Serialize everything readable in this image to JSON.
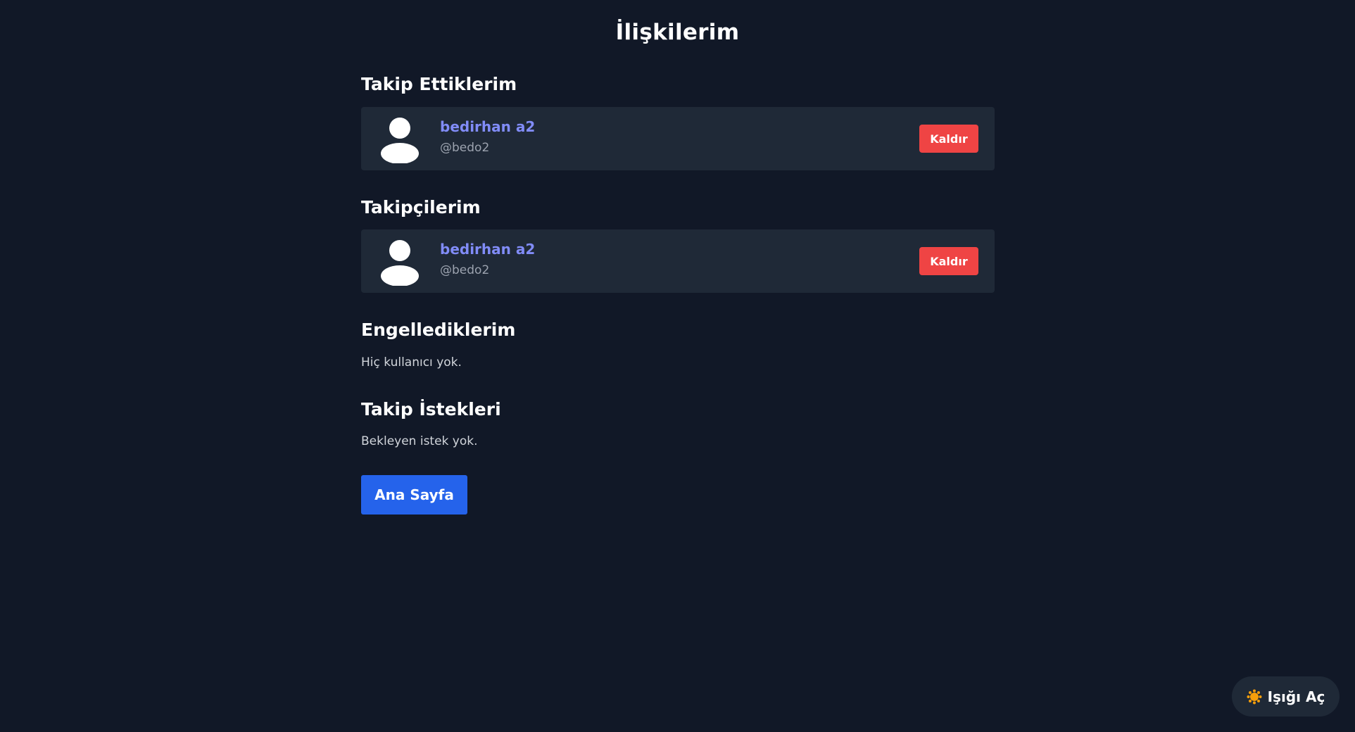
{
  "page": {
    "title": "İlişkilerim"
  },
  "following": {
    "heading": "Takip Ettiklerim",
    "users": [
      {
        "name": "bedirhan a2",
        "handle": "@bedo2",
        "action_label": "Kaldır"
      }
    ]
  },
  "followers": {
    "heading": "Takipçilerim",
    "users": [
      {
        "name": "bedirhan a2",
        "handle": "@bedo2",
        "action_label": "Kaldır"
      }
    ]
  },
  "blocked": {
    "heading": "Engellediklerim",
    "empty_text": "Hiç kullanıcı yok."
  },
  "requests": {
    "heading": "Takip İstekleri",
    "empty_text": "Bekleyen istek yok."
  },
  "nav": {
    "home_label": "Ana Sayfa"
  },
  "theme_toggle": {
    "label": "Işığı Aç",
    "icon": "sun-icon"
  },
  "colors": {
    "background": "#111827",
    "card": "#1f2937",
    "user_name": "#818cf8",
    "handle": "#9ca3af",
    "danger": "#ef4444",
    "primary": "#2563eb",
    "sun": "#f59e0b"
  }
}
